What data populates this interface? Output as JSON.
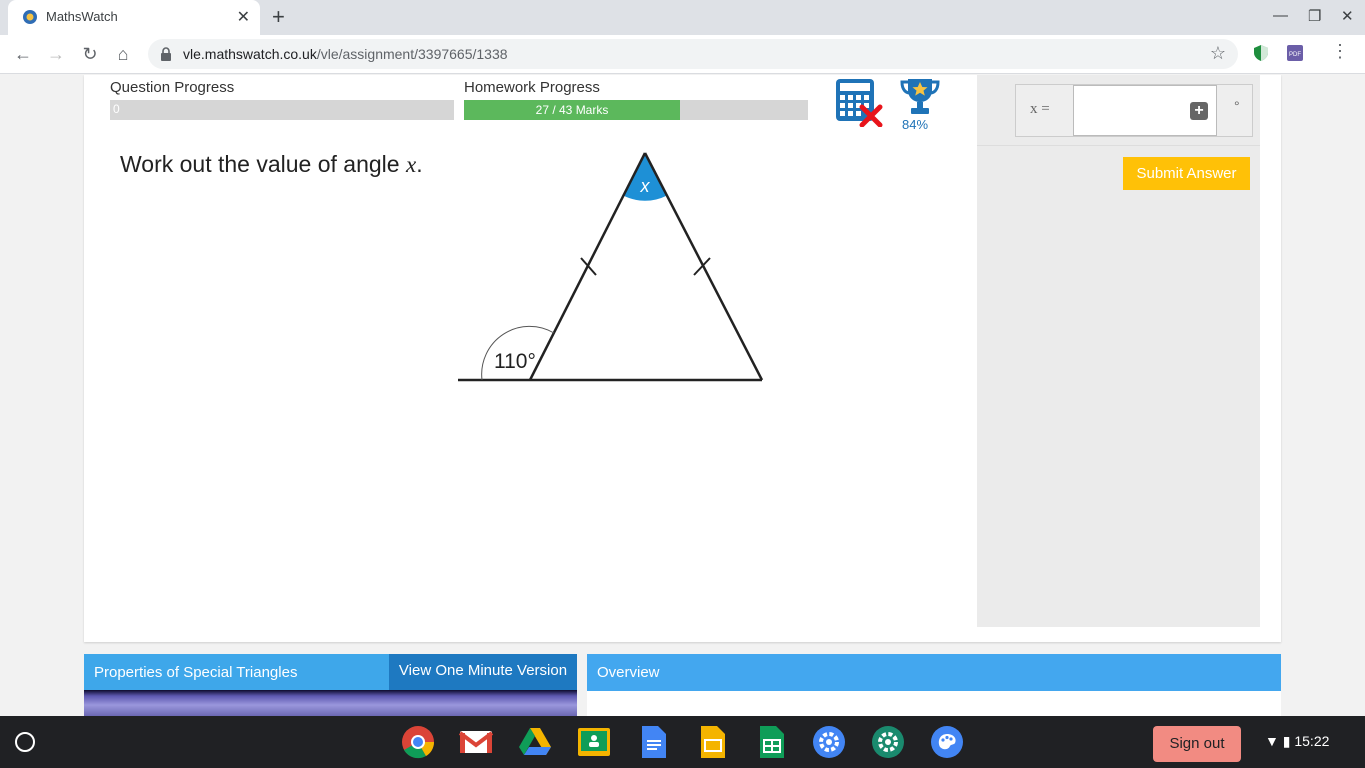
{
  "browser": {
    "tab_title": "MathsWatch",
    "url_domain": "vle.mathswatch.co.uk",
    "url_path": "/vle/assignment/3397665/1338"
  },
  "progress": {
    "question_label": "Question Progress",
    "question_value": "0",
    "homework_label": "Homework Progress",
    "homework_text": "27 / 43 Marks",
    "homework_fraction": 0.628,
    "trophy_percent": "84%"
  },
  "question": {
    "text_prefix": "Work out the value of angle ",
    "variable": "x",
    "text_suffix": "."
  },
  "diagram": {
    "angle_label": "x",
    "exterior_angle": "110°"
  },
  "answer": {
    "label": "x =",
    "value": "",
    "unit": "°",
    "submit_label": "Submit Answer"
  },
  "video": {
    "title": "Properties of Special Triangles",
    "one_minute_label": "View One Minute Version"
  },
  "overview": {
    "title": "Overview"
  },
  "shelf": {
    "signout_label": "Sign out",
    "time": "15:22"
  },
  "colors": {
    "accent_blue": "#3ea7ea",
    "progress_green": "#5cb85c",
    "submit_yellow": "#ffc107"
  }
}
